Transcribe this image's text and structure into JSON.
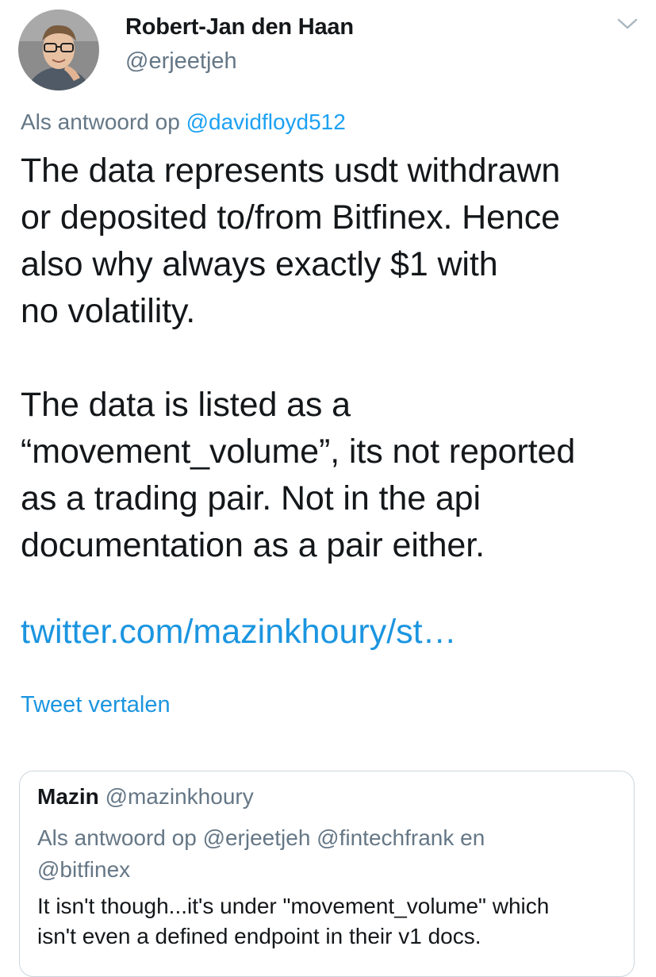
{
  "author": {
    "display_name": "Robert-Jan den Haan",
    "handle": "@erjeetjeh"
  },
  "reply_context": {
    "prefix": "Als antwoord op",
    "mention": "@davidfloyd512"
  },
  "tweet": {
    "paragraph1_lines": [
      "The data represents usdt withdrawn",
      "or deposited to/from Bitfinex. Hence",
      "also why always exactly $1 with",
      "no volatility."
    ],
    "paragraph2_lines": [
      "The data is listed as a",
      "“movement_volume”, its not reported",
      "as a trading pair. Not in the api",
      "documentation as a pair either."
    ],
    "link": "twitter.com/mazinkhoury/st…",
    "translate_label": "Tweet vertalen"
  },
  "quoted_tweet": {
    "name": "Mazin",
    "handle": "@mazinkhoury",
    "reply_line1": "Als antwoord op @erjeetjeh @fintechfrank en",
    "reply_line2": "@bitfinex",
    "text_lines": [
      "It isn't though...it's under \"movement_volume\" which",
      "isn't even a defined endpoint in their v1 docs."
    ]
  },
  "icons": {
    "avatar": "avatar-photo",
    "menu": "chevron-down-icon"
  },
  "colors": {
    "link": "#1b95e0",
    "secondary_text": "#657786",
    "primary_text": "#14171a",
    "border": "#ccd6dd"
  }
}
